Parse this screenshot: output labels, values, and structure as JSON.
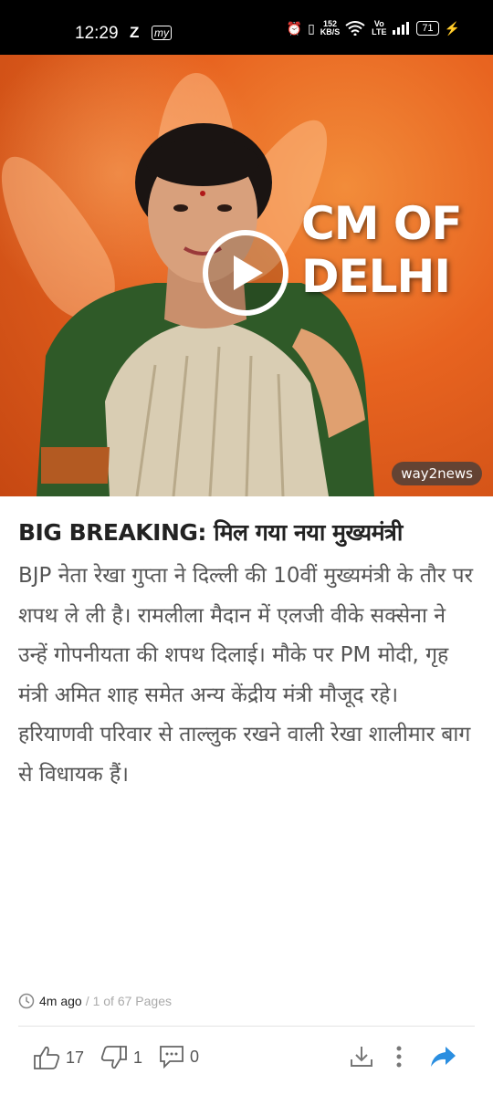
{
  "status_bar": {
    "time": "12:29",
    "z_label": "Z",
    "my_label": "my",
    "net_speed": "152",
    "net_unit": "KB/S",
    "volte": "Vo LTE",
    "battery": "71"
  },
  "media": {
    "overlay_line1": "CM OF",
    "overlay_line2": "DELHI",
    "watermark": "way2news"
  },
  "article": {
    "title": "BIG BREAKING: मिल गया नया मुख्यमंत्री",
    "body": "BJP नेता रेखा गुप्ता ने दिल्ली की 10वीं मुख्यमंत्री के तौर पर शपथ ले ली है। रामलीला मैदान में एलजी वीके सक्सेना ने उन्हें गोपनीयता की शपथ दिलाई। मौके पर PM मोदी, गृह मंत्री अमित शाह समेत अन्य केंद्रीय मंत्री मौजूद रहे। हरियाणवी परिवार से ताल्लुक रखने वाली रेखा शालीमार बाग से विधायक हैं।",
    "time_ago": "4m ago",
    "separator": "/",
    "pages": "1 of 67 Pages"
  },
  "actions": {
    "likes": "17",
    "dislikes": "1",
    "comments": "0",
    "share_color": "#2a8ee0"
  }
}
